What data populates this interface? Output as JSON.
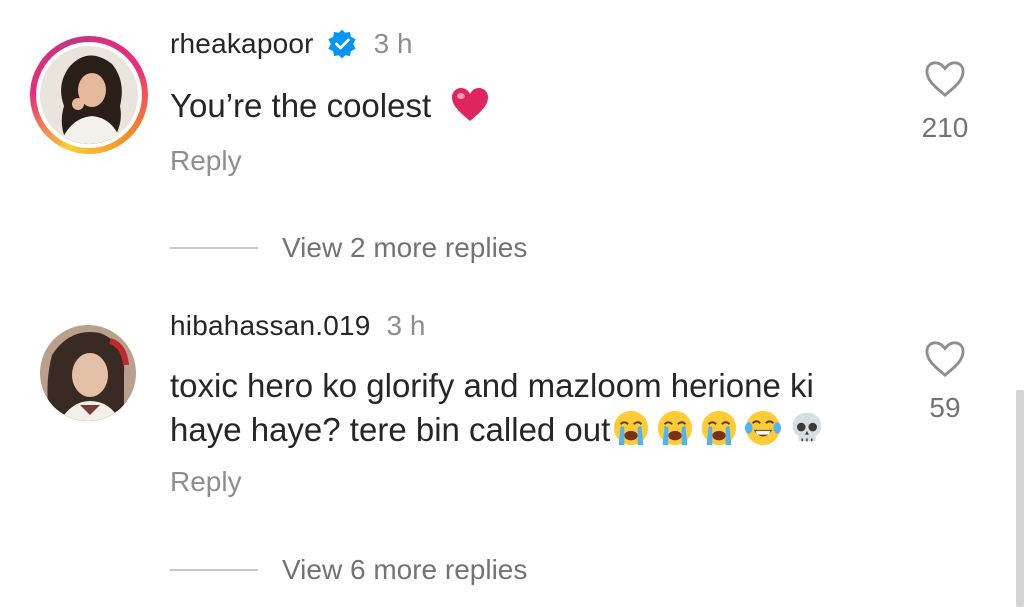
{
  "comments": [
    {
      "username": "rheakapoor",
      "verified": true,
      "time": "3 h",
      "text": "You’re the coolest",
      "emojis": [
        "red-heart"
      ],
      "reply_label": "Reply",
      "likes": "210",
      "view_replies": "View 2 more replies",
      "avatar_has_story_ring": true
    },
    {
      "username": "hibahassan.019",
      "verified": false,
      "time": "3 h",
      "text_line1": "toxic hero ko glorify and mazloom herione ki",
      "text_line2": "haye haye? tere bin called out",
      "emojis": [
        "loudly-crying-face",
        "loudly-crying-face",
        "loudly-crying-face",
        "tears-of-joy-face",
        "skull"
      ],
      "reply_label": "Reply",
      "likes": "59",
      "view_replies": "View 6 more replies",
      "avatar_has_story_ring": false
    }
  ],
  "colors": {
    "primary_text": "#262626",
    "secondary_text": "#8e8e8e",
    "verified_blue": "#0095f6",
    "heart_red": "#e0245e"
  }
}
